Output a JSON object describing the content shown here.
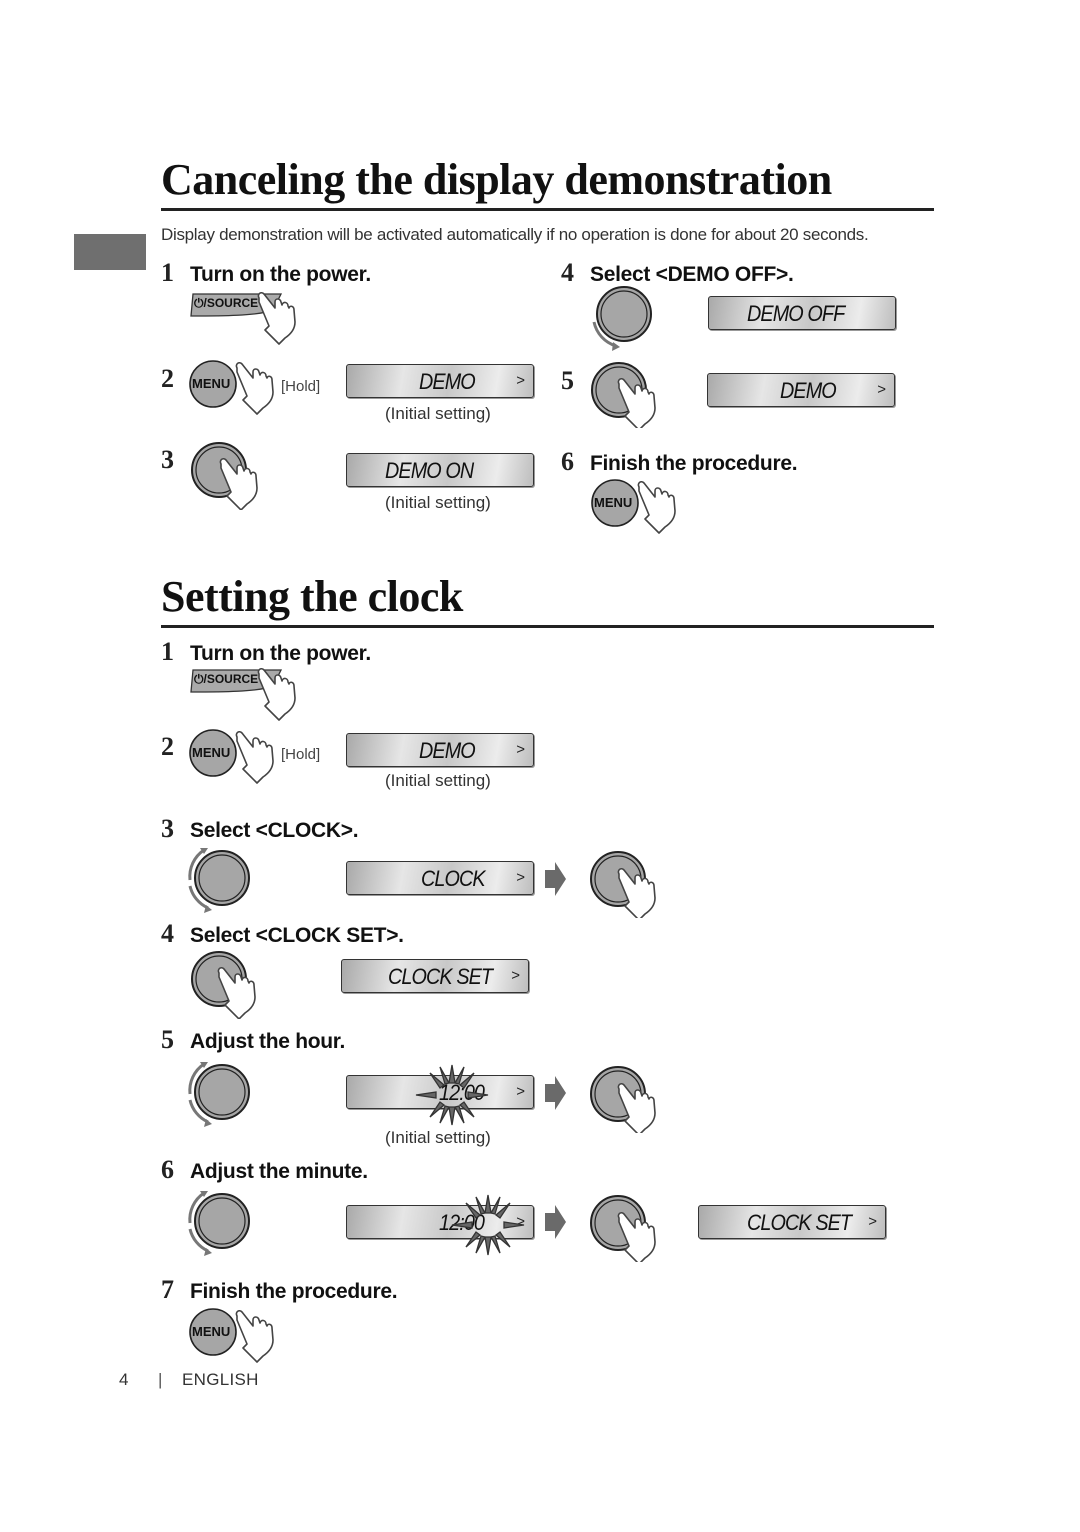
{
  "page": {
    "number": "4",
    "language": "ENGLISH",
    "separator": "|"
  },
  "section1": {
    "title": "Canceling the display demonstration",
    "intro": "Display demonstration will be activated automatically if no operation is done for about 20 seconds.",
    "steps": [
      {
        "num": "1",
        "text": "Turn on the power.",
        "button": "⏻/SOURCE"
      },
      {
        "num": "2",
        "button": "MENU",
        "hold": "[Hold]",
        "display": "DEMO",
        "note": "(Initial setting)"
      },
      {
        "num": "3",
        "display": "DEMO ON",
        "note": "(Initial setting)"
      },
      {
        "num": "4",
        "text": "Select <DEMO OFF>.",
        "display": "DEMO OFF"
      },
      {
        "num": "5",
        "display": "DEMO"
      },
      {
        "num": "6",
        "text": "Finish the procedure.",
        "button": "MENU"
      }
    ]
  },
  "section2": {
    "title": "Setting the clock",
    "steps": [
      {
        "num": "1",
        "text": "Turn on the power.",
        "button": "⏻/SOURCE"
      },
      {
        "num": "2",
        "button": "MENU",
        "hold": "[Hold]",
        "display": "DEMO",
        "note": "(Initial setting)"
      },
      {
        "num": "3",
        "text": "Select <CLOCK>.",
        "display": "CLOCK"
      },
      {
        "num": "4",
        "text": "Select <CLOCK SET>.",
        "display": "CLOCK SET"
      },
      {
        "num": "5",
        "text": "Adjust the hour.",
        "display": "12:00",
        "note": "(Initial setting)",
        "blinking": "hour"
      },
      {
        "num": "6",
        "text": "Adjust the minute.",
        "display": "12:00",
        "blinking": "minute",
        "result_display": "CLOCK SET"
      },
      {
        "num": "7",
        "text": "Finish the procedure.",
        "button": "MENU"
      }
    ]
  },
  "display_chevron": ">"
}
